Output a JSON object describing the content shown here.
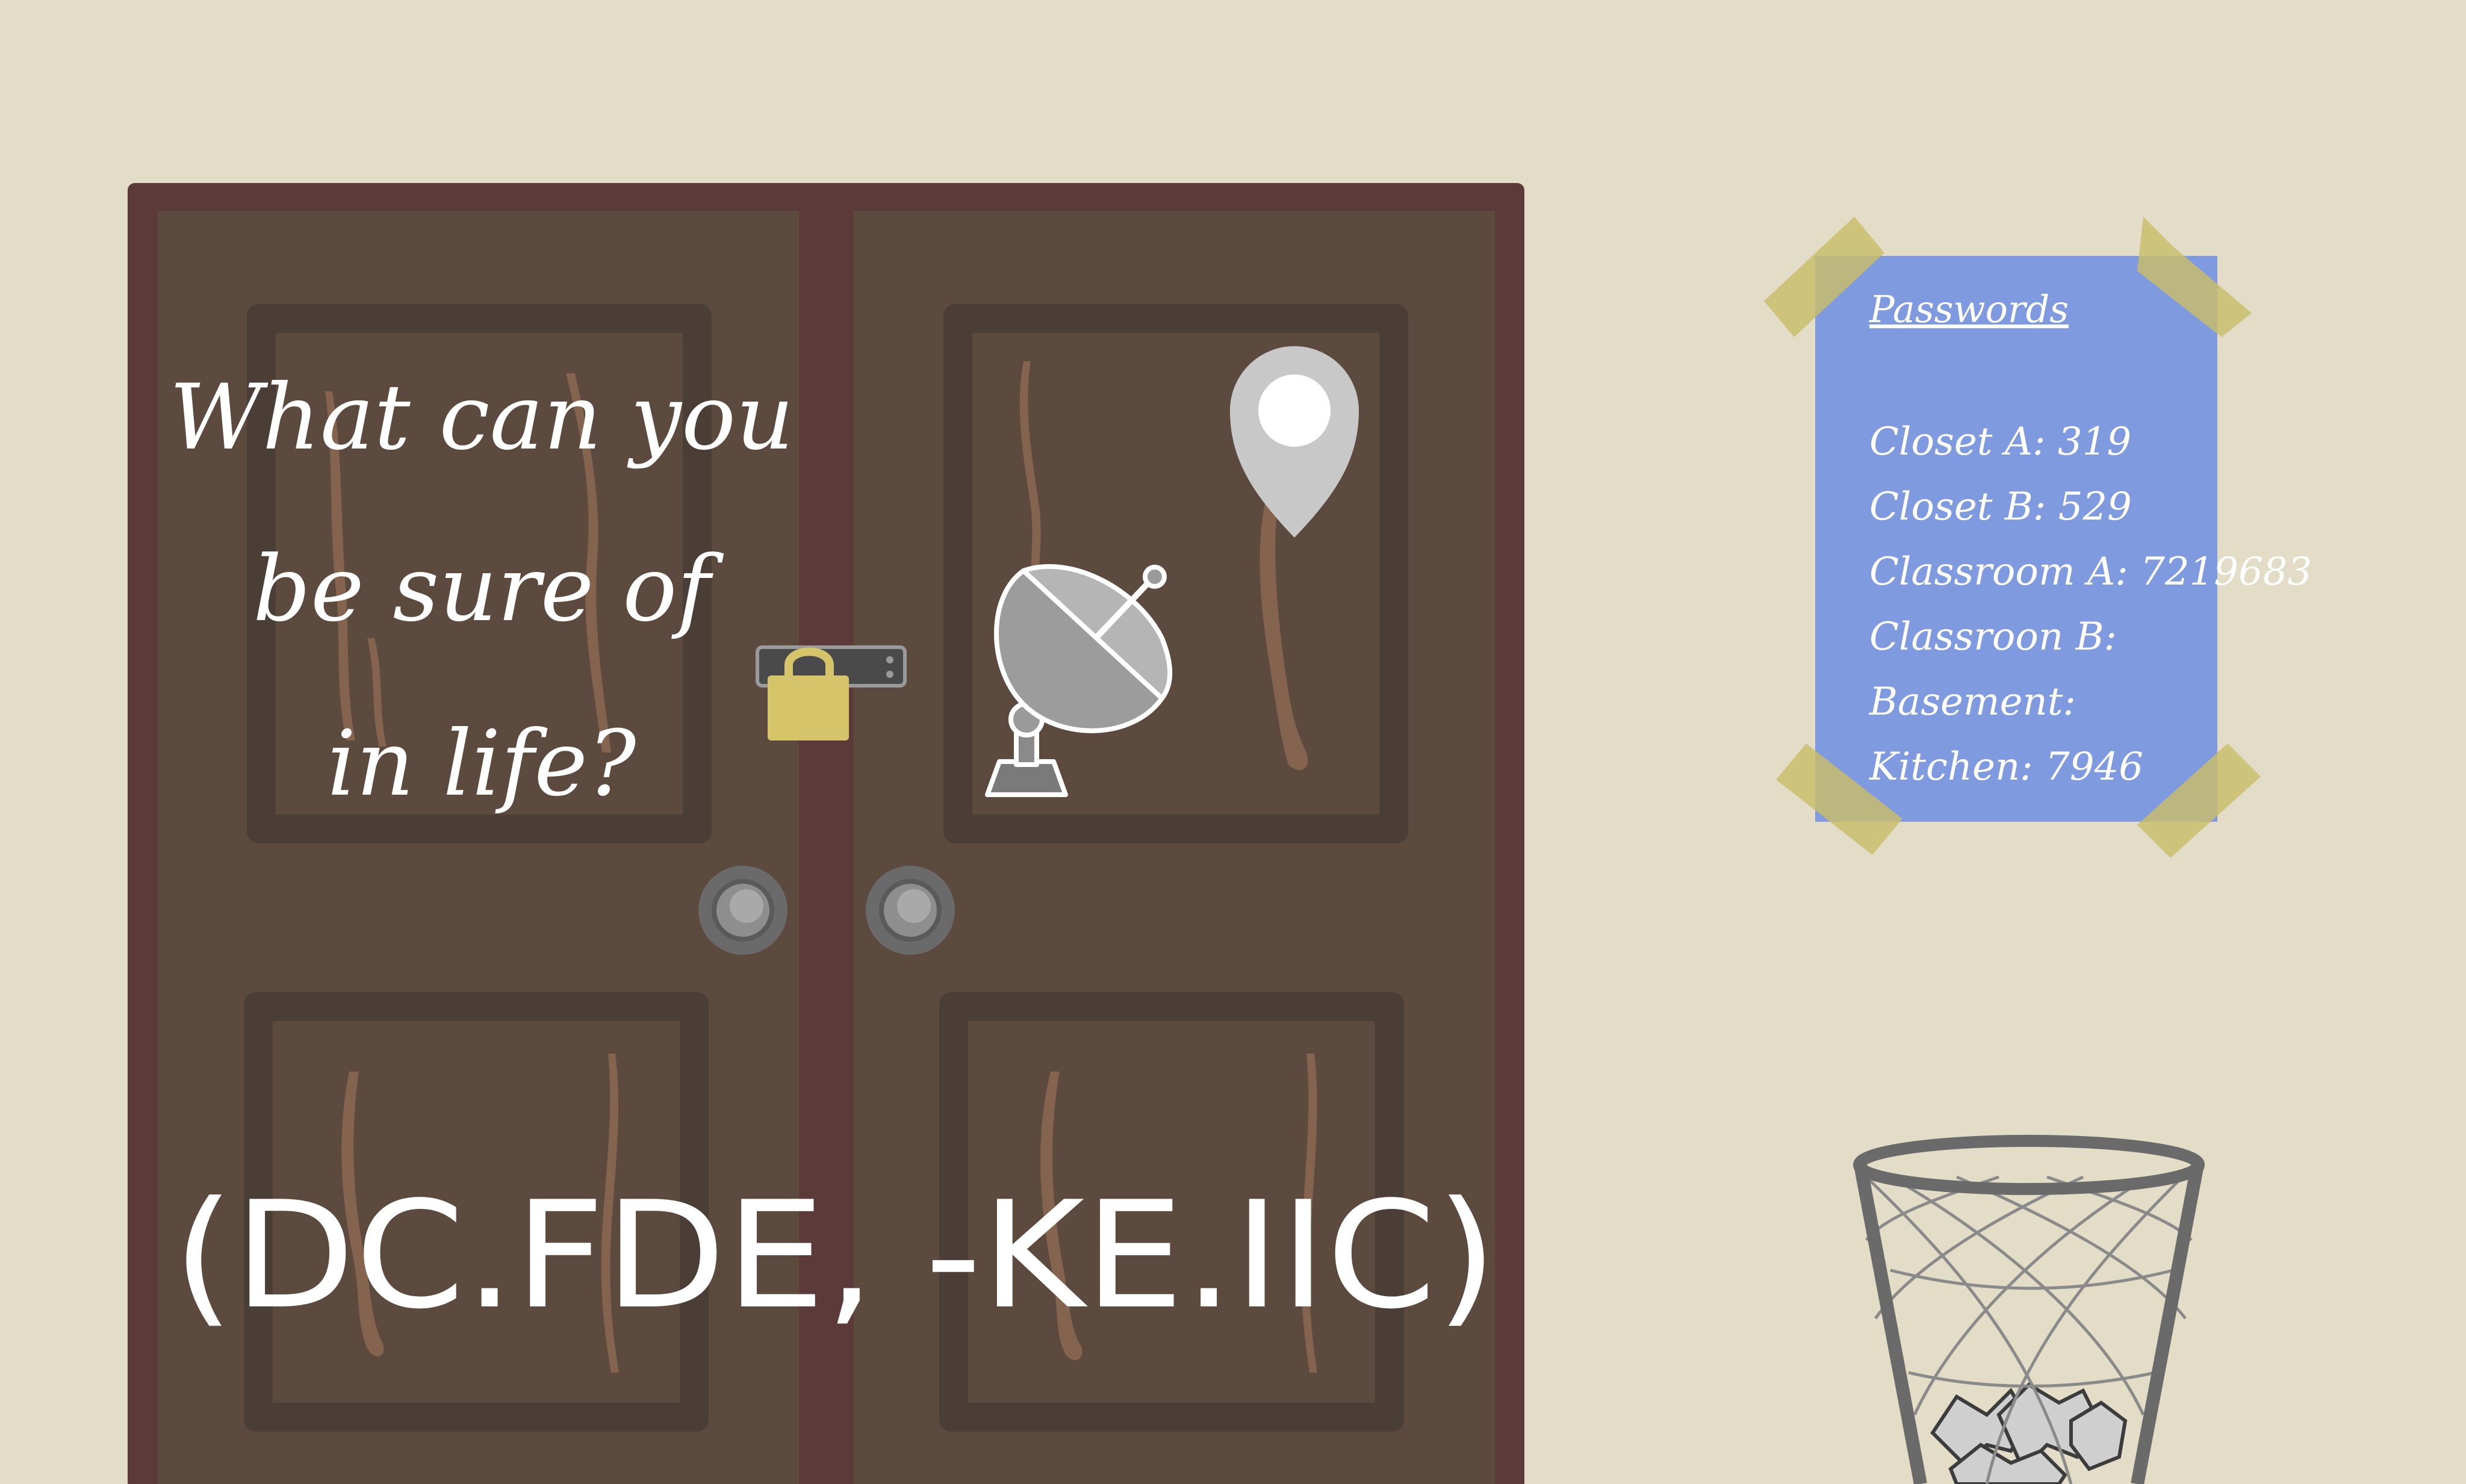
{
  "door_riddle": {
    "line1": "What can you",
    "line2": "be sure of",
    "line3": "in life?"
  },
  "door_code": "(DC.FDE, -KE.IIC)",
  "note": {
    "title": "Passwords",
    "lines": [
      "Closet A: 319",
      "Closet B: 529",
      "Classroom A: 7219683",
      "Classroon B:",
      "Basement:",
      "Kitchen: 7946"
    ]
  },
  "icons": {
    "padlock": "padlock-icon",
    "map_pin": "map-pin-icon",
    "satellite_dish": "satellite-dish-icon",
    "trash_bin": "wastebasket-icon"
  },
  "colors": {
    "wall": "#e3dcc6",
    "door_frame": "#5d3a3a",
    "door_wood": "#5c4a3e",
    "door_panel_border": "#4b3e36",
    "note_paper": "#7f9adf",
    "tape": "#c8bd6a",
    "padlock": "#d6c46a"
  }
}
